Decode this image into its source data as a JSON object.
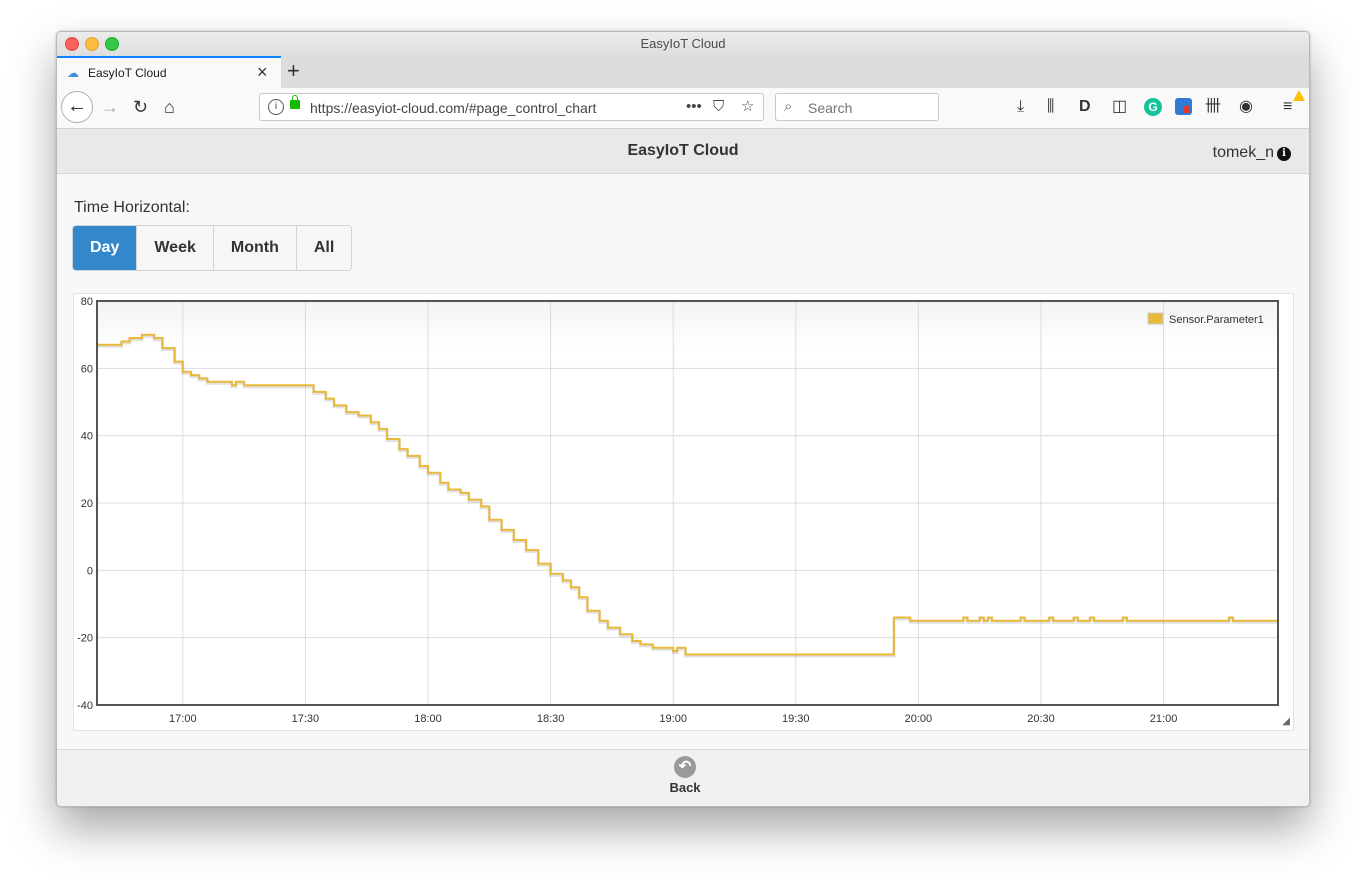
{
  "window": {
    "title": "EasyIoT Cloud"
  },
  "browser": {
    "tab_title": "EasyIoT Cloud",
    "url": "https://easyiot-cloud.com/#page_control_chart",
    "search_placeholder": "Search"
  },
  "app": {
    "title": "EasyIoT Cloud",
    "username": "tomek_n",
    "time_label": "Time Horizontal:",
    "ranges": [
      "Day",
      "Week",
      "Month",
      "All"
    ],
    "active_range": "Day",
    "back_label": "Back"
  },
  "chart_data": {
    "type": "line",
    "series": [
      {
        "name": "Sensor.Parameter1",
        "color": "#e8b93a",
        "points": [
          [
            "16:39",
            67
          ],
          [
            "16:45",
            68
          ],
          [
            "16:47",
            69
          ],
          [
            "16:50",
            70
          ],
          [
            "16:53",
            69
          ],
          [
            "16:55",
            66
          ],
          [
            "16:58",
            62
          ],
          [
            "17:00",
            59
          ],
          [
            "17:02",
            58
          ],
          [
            "17:04",
            57
          ],
          [
            "17:06",
            56
          ],
          [
            "17:12",
            55
          ],
          [
            "17:13",
            56
          ],
          [
            "17:15",
            55
          ],
          [
            "17:30",
            55
          ],
          [
            "17:32",
            53
          ],
          [
            "17:35",
            51
          ],
          [
            "17:37",
            49
          ],
          [
            "17:40",
            47
          ],
          [
            "17:43",
            46
          ],
          [
            "17:46",
            44
          ],
          [
            "17:48",
            42
          ],
          [
            "17:50",
            39
          ],
          [
            "17:53",
            36
          ],
          [
            "17:55",
            34
          ],
          [
            "17:58",
            31
          ],
          [
            "18:00",
            29
          ],
          [
            "18:03",
            26
          ],
          [
            "18:05",
            24
          ],
          [
            "18:08",
            23
          ],
          [
            "18:10",
            21
          ],
          [
            "18:13",
            19
          ],
          [
            "18:15",
            15
          ],
          [
            "18:18",
            12
          ],
          [
            "18:21",
            9
          ],
          [
            "18:24",
            6
          ],
          [
            "18:27",
            2
          ],
          [
            "18:30",
            -1
          ],
          [
            "18:33",
            -3
          ],
          [
            "18:35",
            -5
          ],
          [
            "18:37",
            -8
          ],
          [
            "18:39",
            -12
          ],
          [
            "18:42",
            -15
          ],
          [
            "18:44",
            -17
          ],
          [
            "18:47",
            -19
          ],
          [
            "18:50",
            -21
          ],
          [
            "18:52",
            -22
          ],
          [
            "18:55",
            -23
          ],
          [
            "19:00",
            -24
          ],
          [
            "19:01",
            -23
          ],
          [
            "19:03",
            -25
          ],
          [
            "19:54",
            -25
          ],
          [
            "19:54",
            -14
          ],
          [
            "19:58",
            -15
          ],
          [
            "20:10",
            -15
          ],
          [
            "20:11",
            -14
          ],
          [
            "20:12",
            -15
          ],
          [
            "20:14",
            -15
          ],
          [
            "20:15",
            -14
          ],
          [
            "20:16",
            -15
          ],
          [
            "20:17",
            -14
          ],
          [
            "20:18",
            -15
          ],
          [
            "20:24",
            -15
          ],
          [
            "20:25",
            -14
          ],
          [
            "20:26",
            -15
          ],
          [
            "20:31",
            -15
          ],
          [
            "20:32",
            -14
          ],
          [
            "20:33",
            -15
          ],
          [
            "20:37",
            -15
          ],
          [
            "20:38",
            -14
          ],
          [
            "20:39",
            -15
          ],
          [
            "20:41",
            -15
          ],
          [
            "20:42",
            -14
          ],
          [
            "20:43",
            -15
          ],
          [
            "20:49",
            -15
          ],
          [
            "20:50",
            -14
          ],
          [
            "20:51",
            -15
          ],
          [
            "21:15",
            -15
          ],
          [
            "21:16",
            -14
          ],
          [
            "21:17",
            -15
          ],
          [
            "21:28",
            -15
          ]
        ]
      }
    ],
    "x_ticks": [
      "17:00",
      "17:30",
      "18:00",
      "18:30",
      "19:00",
      "19:30",
      "20:00",
      "20:30",
      "21:00"
    ],
    "y_ticks": [
      80,
      60,
      40,
      20,
      0,
      -20,
      -40
    ],
    "ylim": [
      -40,
      80
    ],
    "xlim": [
      "16:39",
      "21:28"
    ],
    "grid": true,
    "legend": "top-right"
  }
}
